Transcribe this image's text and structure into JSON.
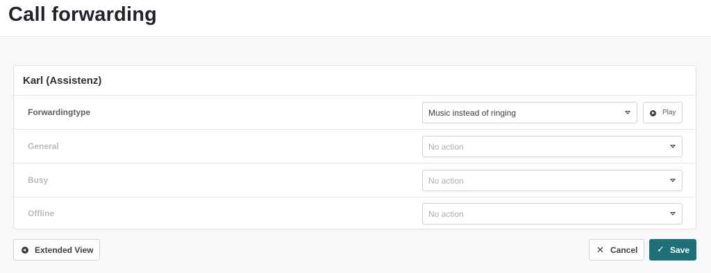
{
  "header": {
    "title": "Call forwarding"
  },
  "card": {
    "title": "Karl (Assistenz)",
    "rows": [
      {
        "label": "Forwardingtype",
        "value": "Music instead of ringing",
        "enabled": true
      },
      {
        "label": "General",
        "value": "No action",
        "enabled": false
      },
      {
        "label": "Busy",
        "value": "No action",
        "enabled": false
      },
      {
        "label": "Offline",
        "value": "No action",
        "enabled": false
      }
    ],
    "play_label": "Play"
  },
  "footer": {
    "extended_view_label": "Extended View",
    "cancel_label": "Cancel",
    "save_label": "Save"
  },
  "colors": {
    "accent": "#1f6f78"
  },
  "icons": {
    "play": "play-circle-icon",
    "extended_view": "arrow-left-circle-icon",
    "cancel": "close-icon",
    "save": "check-icon",
    "select": "caret-down-icon"
  }
}
